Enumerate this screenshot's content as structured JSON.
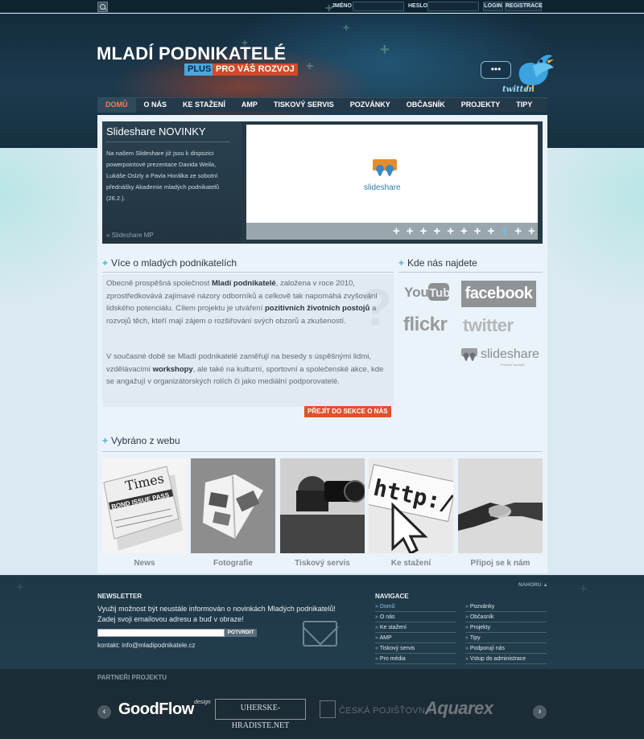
{
  "topbar": {
    "name_label": "JMÉNO",
    "password_label": "HESLO",
    "login_button": "LOGIN",
    "register_button": "REGISTRACE"
  },
  "header": {
    "title": "MLADÍ PODNIKATELÉ",
    "plus": "PLUS",
    "subtitle": "PRO VÁŠ ROZVOJ",
    "twitter_bubble": "•••",
    "twitter_word": "twitter"
  },
  "nav": {
    "items": [
      "DOMŮ",
      "O NÁS",
      "KE STAŽENÍ",
      "AMP",
      "TISKOVÝ SERVIS",
      "POZVÁNKY",
      "OBČASNÍK",
      "PROJEKTY",
      "TIPY"
    ]
  },
  "slideshare_box": {
    "title": "Slideshare NOVINKY",
    "text": "Na našem Slideshare již jsou k dispozici powerpointové prezentace Davida Weila, Lukáše Oslzly a Pavla Horálka ze sobotní přednášky Akademie mladých podnikatelů (26.2.).",
    "more": "» Slideshare MP",
    "logo_text": "slideshare",
    "dots": [
      "+",
      "+",
      "+",
      "+",
      "+",
      "+",
      "+",
      "+",
      "+",
      "+",
      "+"
    ],
    "active_dot": 8
  },
  "about": {
    "heading": "Více o mladých podnikatelích",
    "p1_a": "Obecně prospěšná společnost ",
    "p1_b": "Mladí podnikatelé",
    "p1_c": ", založena v roce 2010, zprostředkovává zajímavé názory odborníků a celkově tak napomáhá zvyšování lidského potenciálu. Cílem projektu je utváření ",
    "p1_d": "pozitivních životních postojů",
    "p1_e": " a rozvojů těch, kteří mají zájem o rozšiřování svých obzorů a zkušeností.",
    "p2_a": "V současné době se Mladí podnikatelé zaměřují na besedy s úspěšnými lidmi, vzdělávacími ",
    "p2_b": "workshopy",
    "p2_c": ", ale také na kulturní, sportovní a společenské akce, kde se angažují v organizátorských rolích či jako mediální podporovatelé.",
    "button": "PŘEJÍT DO SEKCE O NÁS"
  },
  "where": {
    "heading": "Kde nás najdete",
    "youtube": "YouTube",
    "facebook": "facebook",
    "flickr": "flickr",
    "twitter": "twitter",
    "slideshare": "slideshare",
    "slideshare_sub": "Present Yourself"
  },
  "gallery": {
    "heading": "Vybráno z webu",
    "items": [
      "News",
      "Fotografie",
      "Tiskový servis",
      "Ke stažení",
      "Připoj se k nám"
    ],
    "newspaper_text": "Times",
    "newspaper_headline": "BOND ISSUE PASS",
    "url_text": "http:/"
  },
  "footer": {
    "top_link": "NAHORU",
    "newsletter_heading": "NEWSLETTER",
    "newsletter_text": "Využij možnost být neustále informován o novinkách Mladých podnikatelů! Zadej svoji emailovou adresu a buď v obraze!",
    "submit": "POTVRDIT",
    "contact": "kontakt: info@mladipodnikatele.cz",
    "nav_heading": "NAVIGACE",
    "nav_col1": [
      "Domů",
      "O nás",
      "Ke stažení",
      "AMP",
      "Tiskový servis",
      "Pro média"
    ],
    "nav_col2": [
      "Pozvánky",
      "Občasník",
      "Projekty",
      "Tipy",
      "Podporují nás",
      "Vstup do administrace"
    ]
  },
  "partners": {
    "title": "PARTNEŘI PROJEKTU",
    "goodflow": "GoodFlow",
    "goodflow_sup": "design",
    "uh": "UHERSKE-HRADISTE.NET",
    "cp": "ČESKÁ POJIŠŤOVNA",
    "aquarex": "Aquarex",
    "prev": "‹",
    "next": "›"
  }
}
